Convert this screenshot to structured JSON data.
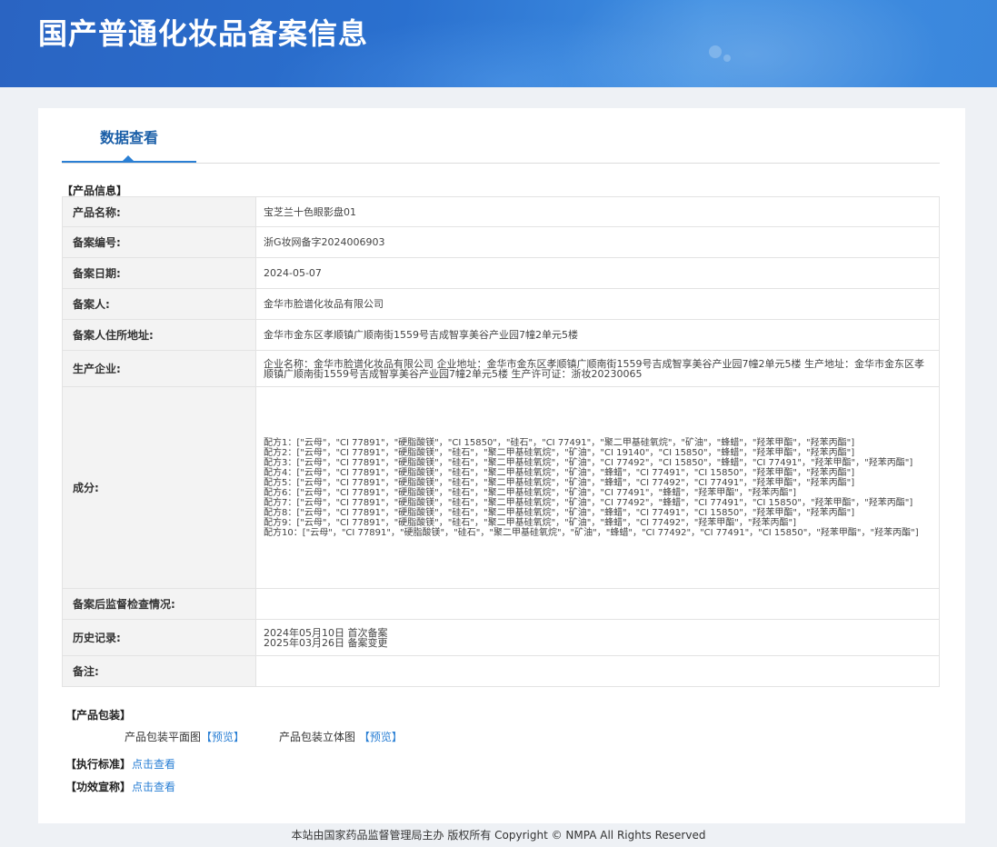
{
  "header": {
    "title": "国产普通化妆品备案信息"
  },
  "tabs": [
    {
      "label": "数据查看"
    }
  ],
  "product_info": {
    "section_title": "【产品信息】",
    "rows": [
      {
        "label": "产品名称:",
        "value": "宝芝兰十色眼影盘01"
      },
      {
        "label": "备案编号:",
        "value": "浙G妆网备字2024006903"
      },
      {
        "label": "备案日期:",
        "value": "2024-05-07"
      },
      {
        "label": "备案人:",
        "value": "金华市脸谱化妆品有限公司"
      },
      {
        "label": "备案人住所地址:",
        "value": "金华市金东区孝顺镇广顺南街1559号吉成智享美谷产业园7幢2单元5楼"
      },
      {
        "label": "生产企业:",
        "value": "企业名称：金华市脸谱化妆品有限公司 企业地址：金华市金东区孝顺镇广顺南街1559号吉成智享美谷产业园7幢2单元5楼 生产地址：金华市金东区孝顺镇广顺南街1559号吉成智享美谷产业园7幢2单元5楼 生产许可证：浙妆20230065"
      },
      {
        "label": "成分:",
        "lines": [
          "配方1：[\"云母\"，\"CI 77891\"，\"硬脂酸镁\"，\"CI 15850\"，\"硅石\"，\"CI 77491\"，\"聚二甲基硅氧烷\"，\"矿油\"，\"蜂蜡\"，\"羟苯甲酯\"，\"羟苯丙酯\"]",
          "配方2：[\"云母\"，\"CI 77891\"，\"硬脂酸镁\"，\"硅石\"，\"聚二甲基硅氧烷\"，\"矿油\"，\"CI 19140\"，\"CI 15850\"，\"蜂蜡\"，\"羟苯甲酯\"，\"羟苯丙酯\"]",
          "配方3：[\"云母\"，\"CI 77891\"，\"硬脂酸镁\"，\"硅石\"，\"聚二甲基硅氧烷\"，\"矿油\"，\"CI 77492\"，\"CI 15850\"，\"蜂蜡\"，\"CI 77491\"，\"羟苯甲酯\"，\"羟苯丙酯\"]",
          "配方4：[\"云母\"，\"CI 77891\"，\"硬脂酸镁\"，\"硅石\"，\"聚二甲基硅氧烷\"，\"矿油\"，\"蜂蜡\"，\"CI 77491\"，\"CI 15850\"，\"羟苯甲酯\"，\"羟苯丙酯\"]",
          "配方5：[\"云母\"，\"CI 77891\"，\"硬脂酸镁\"，\"硅石\"，\"聚二甲基硅氧烷\"，\"矿油\"，\"蜂蜡\"，\"CI 77492\"，\"CI 77491\"，\"羟苯甲酯\"，\"羟苯丙酯\"]",
          "配方6：[\"云母\"，\"CI 77891\"，\"硬脂酸镁\"，\"硅石\"，\"聚二甲基硅氧烷\"，\"矿油\"，\"CI 77491\"，\"蜂蜡\"，\"羟苯甲酯\"，\"羟苯丙酯\"]",
          "配方7：[\"云母\"，\"CI 77891\"，\"硬脂酸镁\"，\"硅石\"，\"聚二甲基硅氧烷\"，\"矿油\"，\"CI 77492\"，\"蜂蜡\"，\"CI 77491\"，\"CI 15850\"，\"羟苯甲酯\"，\"羟苯丙酯\"]",
          "配方8：[\"云母\"，\"CI 77891\"，\"硬脂酸镁\"，\"硅石\"，\"聚二甲基硅氧烷\"，\"矿油\"，\"蜂蜡\"，\"CI 77491\"，\"CI 15850\"，\"羟苯甲酯\"，\"羟苯丙酯\"]",
          "配方9：[\"云母\"，\"CI 77891\"，\"硬脂酸镁\"，\"硅石\"，\"聚二甲基硅氧烷\"，\"矿油\"，\"蜂蜡\"，\"CI 77492\"，\"羟苯甲酯\"，\"羟苯丙酯\"]",
          "配方10：[\"云母\"，\"CI 77891\"，\"硬脂酸镁\"，\"硅石\"，\"聚二甲基硅氧烷\"，\"矿油\"，\"蜂蜡\"，\"CI 77492\"，\"CI 77491\"，\"CI 15850\"，\"羟苯甲酯\"，\"羟苯丙酯\"]"
        ]
      },
      {
        "label": "备案后监督检查情况:",
        "value": ""
      },
      {
        "label": "历史记录:",
        "lines": [
          "2024年05月10日 首次备案",
          "2025年03月26日 备案变更"
        ]
      },
      {
        "label": "备注:",
        "value": ""
      }
    ]
  },
  "packaging": {
    "section_title": "【产品包装】",
    "flat_label": "产品包装平面图",
    "flat_link": "【预览】",
    "solid_label": "产品包装立体图",
    "solid_link": "【预览】"
  },
  "standard": {
    "title": "【执行标准】",
    "link": "点击查看"
  },
  "efficacy": {
    "title": "【功效宣称】",
    "link": "点击查看"
  },
  "footer": {
    "text": "本站由国家药品监督管理局主办 版权所有 Copyright © NMPA All Rights Reserved"
  },
  "colors": {
    "banner": "#2a6bcb",
    "accent": "#2a7fd4",
    "page_bg": "#eef1f5"
  }
}
